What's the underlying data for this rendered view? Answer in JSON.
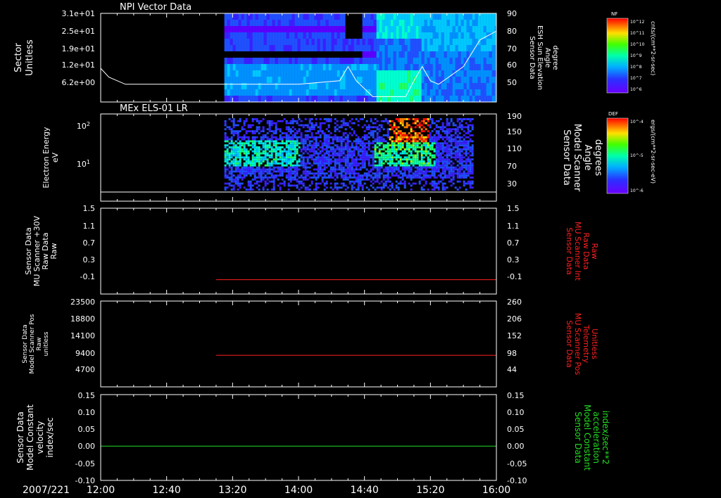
{
  "colors": {
    "background": "#000000",
    "axis": "#ffffff",
    "red_trace": "#ff2020",
    "green_trace": "#22dd22",
    "white_trace": "#ffffff"
  },
  "time_axis": {
    "date": "2007/221",
    "ticks": [
      "12:00",
      "12:40",
      "13:20",
      "14:00",
      "14:40",
      "15:20",
      "16:00"
    ]
  },
  "chart_data": [
    {
      "type": "heatmap",
      "title": "NPI Vector Data",
      "ylabel": [
        "Sector",
        "Unitless"
      ],
      "yticks": [
        "3.1e+01",
        "2.5e+01",
        "1.9e+01",
        "1.2e+01",
        "6.2e+00"
      ],
      "right_label": [
        "Sensor Data",
        "ESH Sun Elevation",
        "Angle",
        "degree"
      ],
      "right_ticks": [
        "90",
        "80",
        "70",
        "60",
        "50"
      ],
      "data_start": "13:15",
      "data_end": "16:00",
      "overlay_line": {
        "name": "ESH Sun Elevation",
        "color": "white",
        "x": [
          "12:00",
          "12:05",
          "12:15",
          "14:00",
          "14:25",
          "14:30",
          "14:35",
          "14:45",
          "14:50",
          "15:05",
          "15:10",
          "15:15",
          "15:20",
          "15:25",
          "15:40",
          "15:50",
          "16:00"
        ],
        "y": [
          59,
          54,
          50,
          50,
          52,
          60,
          52,
          43,
          43,
          43,
          52,
          60,
          52,
          50,
          60,
          75,
          80
        ]
      },
      "colorbar": {
        "label": "NF",
        "units": "cnts/(cm**2-sr-sec)",
        "ticks": [
          "10^12",
          "10^11",
          "10^10",
          "10^9",
          "10^8",
          "10^7",
          "10^6"
        ]
      }
    },
    {
      "type": "heatmap",
      "title": "MEx ELS-01 LR",
      "ylabel": [
        "Electron Energy",
        "eV"
      ],
      "yticks": [
        "10^2",
        "10^1"
      ],
      "right_label": [
        "Sensor Data",
        "Model Scanner",
        "Angle",
        "degrees"
      ],
      "right_ticks": [
        "190",
        "150",
        "110",
        "70",
        "30"
      ],
      "data_start": "13:15",
      "data_end": "15:45",
      "overlay_line": {
        "name": "Model Scanner Angle",
        "color": "white",
        "x": [
          "12:00",
          "16:00"
        ],
        "y": [
          20,
          20
        ]
      },
      "colorbar": {
        "label": "DEF",
        "units": "ergs/(cm**2-sr-sec-eV)",
        "ticks": [
          "10^-4",
          "10^-5",
          "10^-6"
        ]
      }
    },
    {
      "type": "line",
      "ylabel": [
        "Sensor Data",
        "MU Scanner +30V",
        "Raw Data",
        "Raw"
      ],
      "yticks": [
        "1.5",
        "1.1",
        "0.7",
        "0.3",
        "-0.1"
      ],
      "right_label": [
        "Sensor Data",
        "MU Scanner Int",
        "Raw Data",
        "Raw"
      ],
      "right_ticks": [
        "1.5",
        "1.1",
        "0.7",
        "0.3",
        "-0.1"
      ],
      "series": [
        {
          "color": "red",
          "x": [
            "13:10",
            "16:00"
          ],
          "y": [
            0.0,
            0.0
          ]
        }
      ]
    },
    {
      "type": "line",
      "ylabel": [
        "Sensor Data",
        "Model Scanner Pos",
        "Raw",
        "unitless"
      ],
      "yticks": [
        "23500",
        "18800",
        "14100",
        "9400",
        "4700"
      ],
      "right_label": [
        "Sensor Data",
        "MU Scanner Pos",
        "Telemetry",
        "Unitless"
      ],
      "right_ticks": [
        "260",
        "206",
        "152",
        "98",
        "44"
      ],
      "series": [
        {
          "color": "red",
          "x": [
            "13:10",
            "16:00"
          ],
          "y": [
            8000,
            8000
          ]
        }
      ]
    },
    {
      "type": "line",
      "ylabel": [
        "Sensor Data",
        "Model Constant",
        "velocity",
        "index/sec"
      ],
      "yticks": [
        "0.15",
        "0.10",
        "0.05",
        "0.00",
        "-0.05",
        "-0.10"
      ],
      "right_label": [
        "Sensor Data",
        "Model Constant",
        "acceleration",
        "index/sec**2"
      ],
      "right_ticks": [
        "0.15",
        "0.10",
        "0.05",
        "0.00",
        "-0.05",
        "-0.10"
      ],
      "series": [
        {
          "color": "green",
          "x": [
            "12:00",
            "16:00"
          ],
          "y": [
            0.0,
            0.0
          ]
        }
      ]
    }
  ]
}
